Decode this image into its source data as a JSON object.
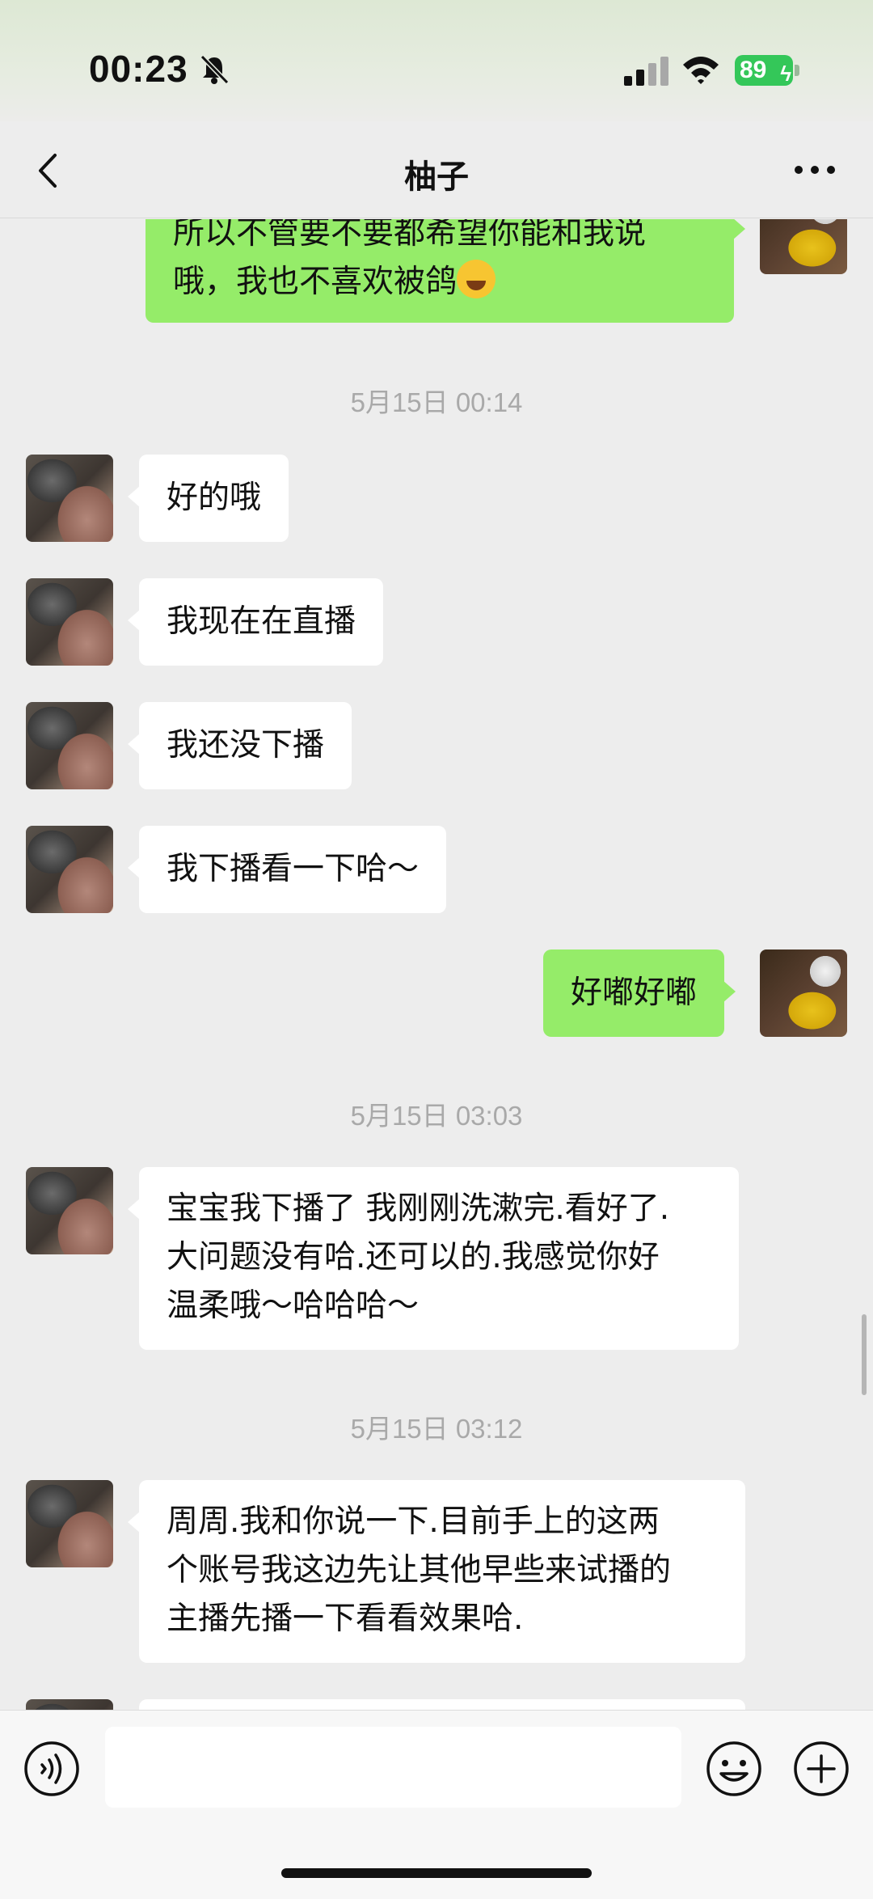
{
  "status_bar": {
    "time": "00:23",
    "battery": "89"
  },
  "nav": {
    "title": "柚子"
  },
  "messages": [
    {
      "type": "out",
      "text": "所以不管要不要都希望你能和我说",
      "text2": "哦，我也不喜欢被鸽"
    },
    {
      "type": "timestamp",
      "text": "5月15日 00:14"
    },
    {
      "type": "in",
      "text": "好的哦"
    },
    {
      "type": "in",
      "text": "我现在在直播"
    },
    {
      "type": "in",
      "text": "我还没下播"
    },
    {
      "type": "in",
      "text": "我下播看一下哈～"
    },
    {
      "type": "out",
      "text": "好嘟好嘟"
    },
    {
      "type": "timestamp",
      "text": "5月15日 03:03"
    },
    {
      "type": "in",
      "lines": [
        "宝宝我下播了 我刚刚洗漱完.看好了.",
        "大问题没有哈.还可以的.我感觉你好",
        "温柔哦～哈哈哈～"
      ]
    },
    {
      "type": "timestamp",
      "text": "5月15日 03:12"
    },
    {
      "type": "in",
      "lines": [
        "周周.我和你说一下.目前手上的这两",
        "个账号我这边先让其他早些来试播的",
        "主播先播一下看看效果哈."
      ]
    }
  ],
  "input": {
    "placeholder": ""
  },
  "icons": {
    "back": "chevron-left-icon",
    "more": "more-dots-icon",
    "voice": "voice-icon",
    "emoji": "emoji-icon",
    "plus": "plus-icon",
    "mute": "bell-slash-icon",
    "signal": "cellular-signal-icon",
    "wifi": "wifi-icon",
    "battery": "battery-icon"
  },
  "colors": {
    "out_bubble": "#95ec69",
    "in_bubble": "#ffffff",
    "background": "#ededed",
    "battery": "#34c759"
  }
}
